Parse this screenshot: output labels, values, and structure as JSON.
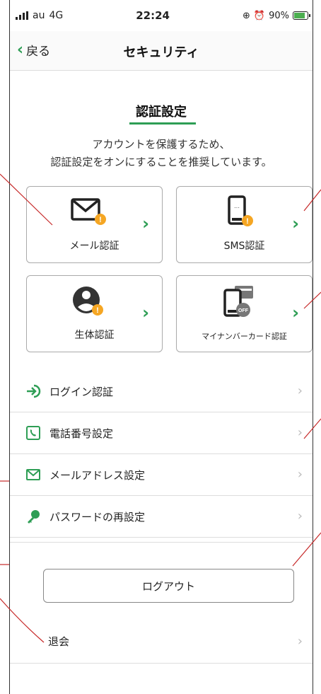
{
  "status": {
    "carrier": "au",
    "network": "4G",
    "time": "22:24",
    "battery_text": "90%",
    "battery_level": 0.9
  },
  "nav": {
    "back_label": "戻る",
    "title": "セキュリティ"
  },
  "section": {
    "title": "認証設定",
    "desc_line1": "アカウントを保護するため、",
    "desc_line2": "認証設定をオンにすることを推奨しています。"
  },
  "cards": {
    "mail": {
      "label": "メール認証",
      "icon": "mail-icon",
      "badge": "!"
    },
    "sms": {
      "label": "SMS認証",
      "icon": "smartphone-icon",
      "badge": "!"
    },
    "bio": {
      "label": "生体認証",
      "icon": "user-icon",
      "badge": "!"
    },
    "mynumber": {
      "label": "マイナンバーカード認証",
      "icon": "mynumber-card-icon",
      "badge": "OFF"
    }
  },
  "list": {
    "login": "ログイン認証",
    "phone": "電話番号設定",
    "email": "メールアドレス設定",
    "password": "パスワードの再設定"
  },
  "logout_label": "ログアウト",
  "withdraw_label": "退会",
  "colors": {
    "accent": "#2e9e55",
    "warning": "#f5a623",
    "annotation": "#c62828"
  }
}
